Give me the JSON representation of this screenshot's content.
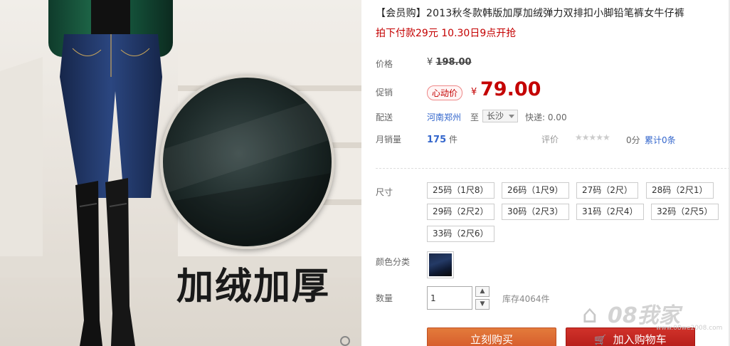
{
  "product_image": {
    "caption": "加绒加厚",
    "zoom_icon": "magnifier-icon"
  },
  "product": {
    "title": "【会员购】2013秋冬款韩版加厚加绒弹力双排扣小脚铅笔裤女牛仔裤",
    "subtitle": "拍下付款29元 10.30日9点开抢"
  },
  "price": {
    "label": "价格",
    "currency": "¥",
    "original": "198.00"
  },
  "promo": {
    "label": "促销",
    "tag": "心动价",
    "currency": "¥",
    "price": "79.00"
  },
  "shipping": {
    "label": "配送",
    "from": "河南郑州",
    "to_word": "至",
    "destination": "长沙",
    "fee": "快递: 0.00"
  },
  "sales": {
    "label": "月销量",
    "count": "175",
    "unit": "件"
  },
  "rating": {
    "label": "评价",
    "stars": "★★★★★",
    "score": "0分",
    "count_text": "累计0条"
  },
  "size": {
    "label": "尺寸",
    "options": [
      "25码（1尺8）",
      "26码（1尺9）",
      "27码（2尺）",
      "28码（2尺1）",
      "29码（2尺2）",
      "30码（2尺3）",
      "31码（2尺4）",
      "32码（2尺5）",
      "33码（2尺6）"
    ]
  },
  "color": {
    "label": "颜色分类"
  },
  "quantity": {
    "label": "数量",
    "value": "1",
    "up_icon": "▲",
    "down_icon": "▼",
    "stock": "库存4064件"
  },
  "actions": {
    "buy": "立刻购买",
    "cart": "加入购物车",
    "cart_icon": "🛒"
  },
  "watermark": {
    "brand": "08我家",
    "sub": "www.08we2008.com"
  },
  "colors": {
    "accent_red": "#c40000",
    "link_blue": "#3366cc",
    "buy_orange": "#d4572a",
    "cart_red": "#b11a17"
  }
}
